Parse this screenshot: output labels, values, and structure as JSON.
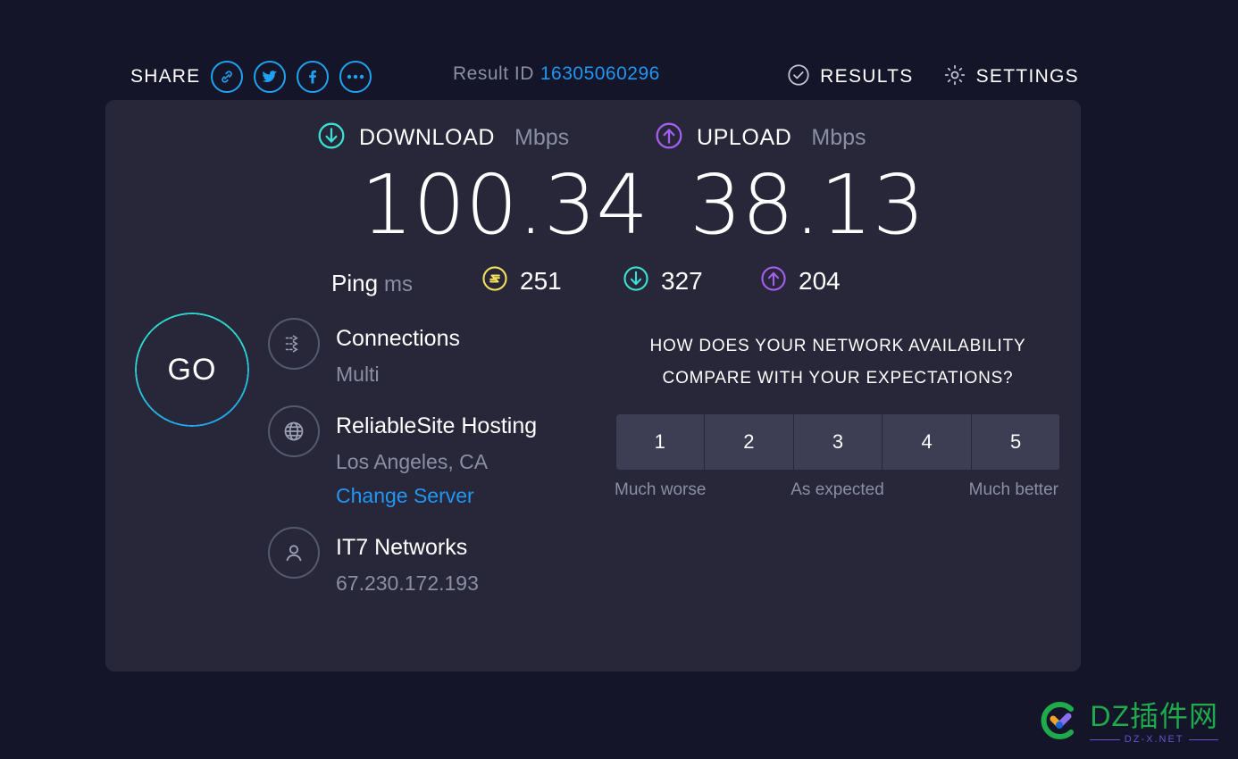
{
  "header": {
    "share_label": "SHARE",
    "share_icons": [
      "link-icon",
      "twitter-icon",
      "facebook-icon",
      "more-icon"
    ],
    "result_id_label": "Result ID",
    "result_id_value": "16305060296",
    "results_label": "RESULTS",
    "settings_label": "SETTINGS"
  },
  "speeds": {
    "download": {
      "title": "DOWNLOAD",
      "unit": "Mbps",
      "value": "100.34",
      "color": "#3ce0d2"
    },
    "upload": {
      "title": "UPLOAD",
      "unit": "Mbps",
      "value": "38.13",
      "color": "#a55ff0"
    }
  },
  "ping": {
    "label": "Ping",
    "unit": "ms",
    "idle": "251",
    "download": "327",
    "upload": "204",
    "idle_color": "#f2e05a",
    "download_color": "#3ce0d2",
    "upload_color": "#a55ff0"
  },
  "go_button": {
    "label": "GO"
  },
  "info": {
    "connections": {
      "title": "Connections",
      "value": "Multi"
    },
    "server": {
      "name": "ReliableSite Hosting",
      "location": "Los Angeles, CA",
      "change_link": "Change Server"
    },
    "isp": {
      "name": "IT7 Networks",
      "ip": "67.230.172.193"
    }
  },
  "survey": {
    "question": "HOW DOES YOUR NETWORK AVAILABILITY COMPARE WITH YOUR EXPECTATIONS?",
    "options": [
      "1",
      "2",
      "3",
      "4",
      "5"
    ],
    "label_low": "Much worse",
    "label_mid": "As expected",
    "label_high": "Much better"
  },
  "watermark": {
    "title": "DZ插件网",
    "subtitle": "DZ-X.NET"
  },
  "colors": {
    "page_bg": "#15152a",
    "card_bg": "#272739",
    "accent_blue": "#2196f3",
    "share_blue": "#1fa2f0",
    "muted": "#8a8fa3"
  }
}
